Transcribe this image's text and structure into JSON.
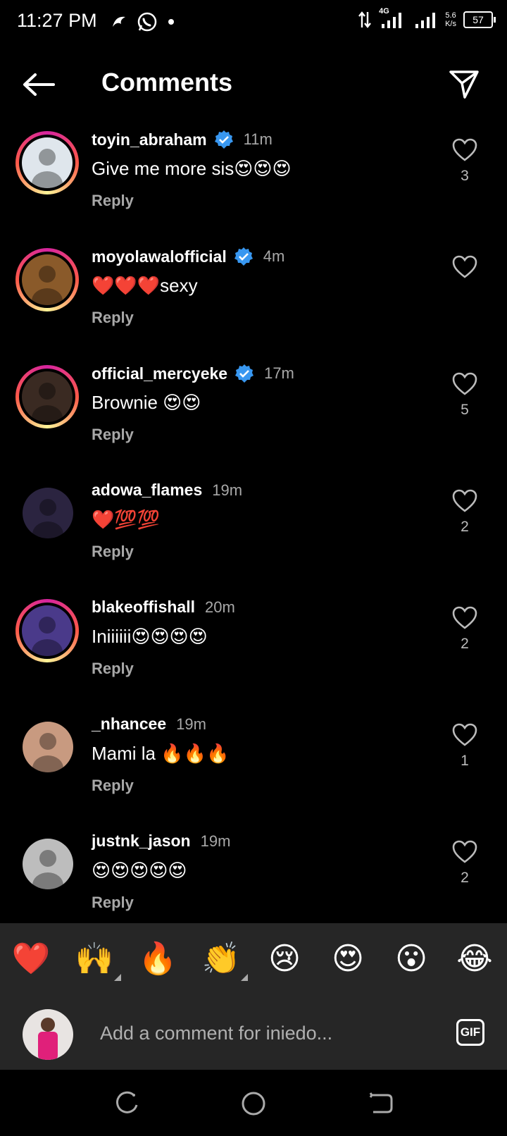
{
  "status_bar": {
    "time": "11:27 PM",
    "network": "4G",
    "speed_value": "5.6",
    "speed_unit": "K/s",
    "battery": "57"
  },
  "header": {
    "title": "Comments"
  },
  "comments": [
    {
      "username": "toyin_abraham",
      "verified": true,
      "time": "11m",
      "text": "Give me more sis😍😍😍",
      "reply": "Reply",
      "likes": "3",
      "ring": true,
      "avatar_color": "#dfe6ec"
    },
    {
      "username": "moyolawalofficial",
      "verified": true,
      "time": "4m",
      "text": "❤️❤️❤️sexy",
      "reply": "Reply",
      "likes": "",
      "ring": true,
      "avatar_color": "#8a5a2a"
    },
    {
      "username": "official_mercyeke",
      "verified": true,
      "time": "17m",
      "text": "Brownie 😍😍",
      "reply": "Reply",
      "likes": "5",
      "ring": true,
      "avatar_color": "#3a2a22"
    },
    {
      "username": "adowa_flames",
      "verified": false,
      "time": "19m",
      "text": "❤️💯💯",
      "reply": "Reply",
      "likes": "2",
      "ring": false,
      "avatar_color": "#2b2440"
    },
    {
      "username": "blakeoffishall",
      "verified": false,
      "time": "20m",
      "text": "Iniiiiii😍😍😍😍",
      "reply": "Reply",
      "likes": "2",
      "ring": true,
      "avatar_color": "#4a3a8a"
    },
    {
      "username": "_nhancee",
      "verified": false,
      "time": "19m",
      "text": "Mami la 🔥🔥🔥",
      "reply": "Reply",
      "likes": "1",
      "ring": false,
      "avatar_color": "#c89a80"
    },
    {
      "username": "justnk_jason",
      "verified": false,
      "time": "19m",
      "text": "😍😍😍😍😍",
      "reply": "Reply",
      "likes": "2",
      "ring": false,
      "avatar_color": "#bdbdbd"
    }
  ],
  "emoji_bar": [
    "❤️",
    "🙌",
    "🔥",
    "👏",
    "😢",
    "😍",
    "😮",
    "😂"
  ],
  "comment_input": {
    "placeholder": "Add a comment for iniedo...",
    "gif_label": "GIF"
  },
  "colors": {
    "background": "#000000",
    "panel": "#262626",
    "verified": "#3897f0",
    "muted_text": "#a8a8a8"
  }
}
